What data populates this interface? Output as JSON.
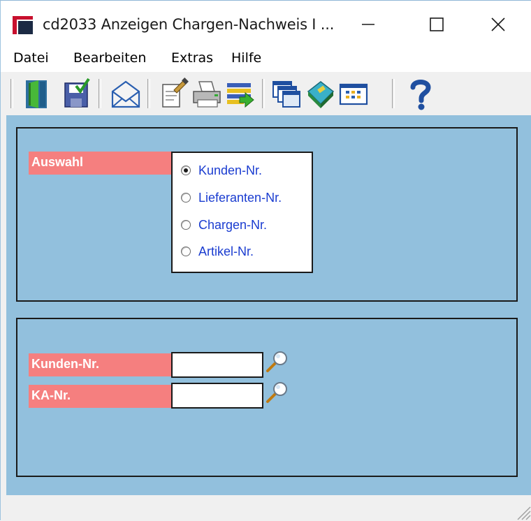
{
  "window": {
    "title": "cd2033 Anzeigen Chargen-Nachweis I ...",
    "minimize_glyph": "—",
    "maximize_glyph": "☐",
    "close_glyph": "✕"
  },
  "menu": [
    {
      "label": "Datei"
    },
    {
      "label": "Bearbeiten"
    },
    {
      "label": "Extras"
    },
    {
      "label": "Hilfe"
    }
  ],
  "toolbar": [
    {
      "icon": "exit-door-icon"
    },
    {
      "icon": "save-icon"
    },
    {
      "icon": "mail-icon"
    },
    {
      "icon": "edit-document-icon"
    },
    {
      "icon": "print-icon"
    },
    {
      "icon": "list-transfer-icon"
    },
    {
      "icon": "windows-icon"
    },
    {
      "icon": "book-icon"
    },
    {
      "icon": "table-icon"
    },
    {
      "icon": "help-icon"
    }
  ],
  "auswahl": {
    "label": "Auswahl",
    "options": [
      {
        "label": "Kunden-Nr.",
        "selected": true
      },
      {
        "label": "Lieferanten-Nr.",
        "selected": false
      },
      {
        "label": "Chargen-Nr.",
        "selected": false
      },
      {
        "label": "Artikel-Nr.",
        "selected": false
      }
    ]
  },
  "fields": {
    "kunden": {
      "label": "Kunden-Nr.",
      "value": ""
    },
    "ka": {
      "label": "KA-Nr.",
      "value": ""
    }
  },
  "colors": {
    "client_bg": "#92c0dd",
    "label_bg": "#f57f7f",
    "option_text": "#1a3cd0"
  }
}
